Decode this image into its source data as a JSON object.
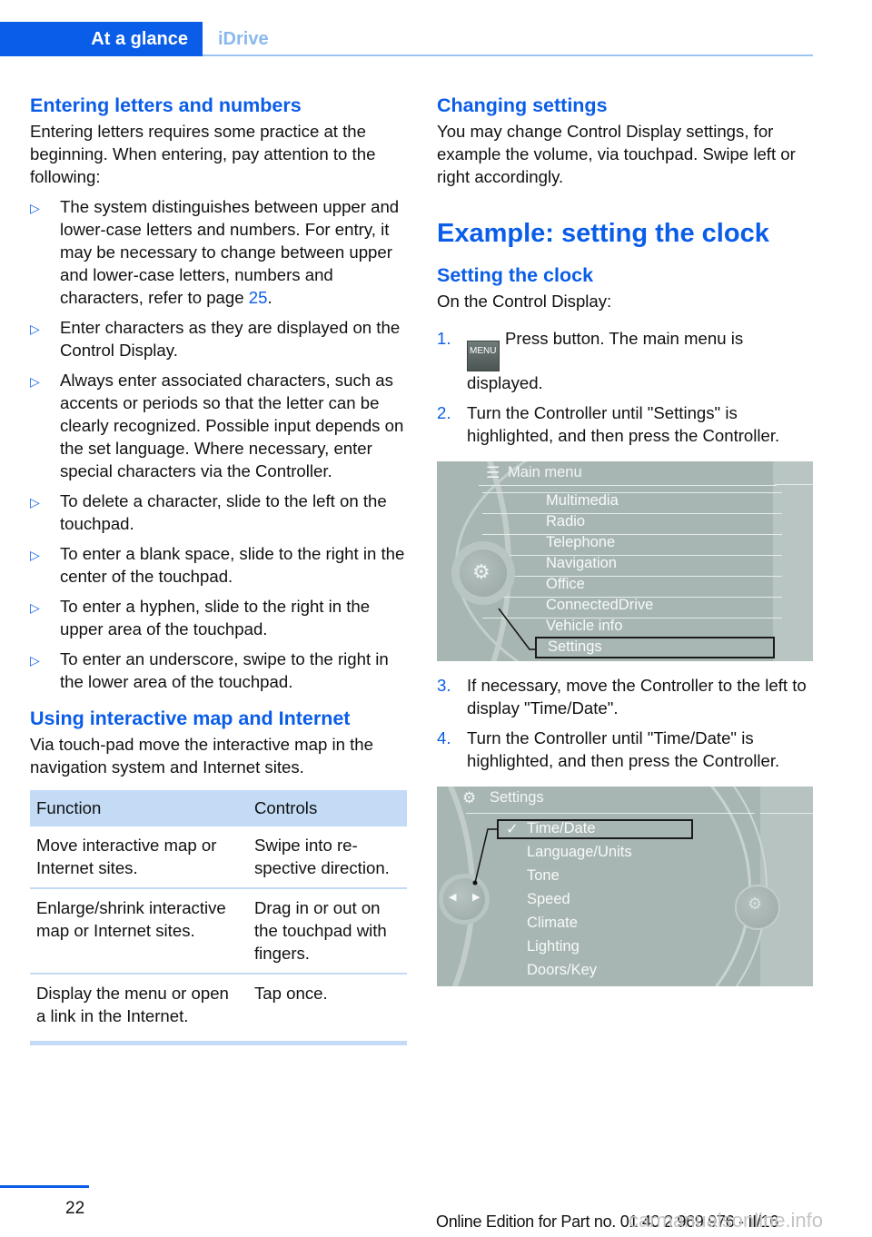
{
  "header": {
    "active_tab": "At a glance",
    "inactive_tab": "iDrive"
  },
  "left": {
    "section1": {
      "title": "Entering letters and numbers",
      "intro": "Entering letters requires some practice at the beginning. When entering, pay attention to the following:",
      "bullets": [
        {
          "text": "The system distinguishes between upper and lower-case letters and numbers. For entry, it may be necessary to change between upper and lower-case letters, numbers and characters, refer to page ",
          "link": "25",
          "after": "."
        },
        {
          "text": "Enter characters as they are displayed on the Control Display."
        },
        {
          "text": "Always enter associated characters, such as accents or periods so that the letter can be clearly recognized. Possible input depends on the set language. Where necessary, enter special characters via the Controller."
        },
        {
          "text": "To delete a character, slide to the left on the touchpad."
        },
        {
          "text": "To enter a blank space, slide to the right in the center of the touchpad."
        },
        {
          "text": "To enter a hyphen, slide to the right in the upper area of the touchpad."
        },
        {
          "text": "To enter an underscore, swipe to the right in the lower area of the touchpad."
        }
      ],
      "bullet_glyph": "▷"
    },
    "section2": {
      "title": "Using interactive map and Internet",
      "intro": "Via touch-pad move the interactive map in the navigation system and Internet sites.",
      "table": {
        "headers": [
          "Function",
          "Controls"
        ],
        "rows": [
          [
            "Move interactive map or Internet sites.",
            "Swipe into re­spective direc­tion."
          ],
          [
            "Enlarge/shrink interactive map or Internet sites.",
            "Drag in or out on the touchpad with fingers."
          ],
          [
            "Display the menu or open a link in the Internet.",
            "Tap once."
          ]
        ]
      }
    }
  },
  "right": {
    "section1": {
      "title": "Changing settings",
      "body": "You may change Control Display settings, for example the volume, via touchpad. Swipe left or right accordingly."
    },
    "section2": {
      "title": "Example: setting the clock",
      "subtitle": "Setting the clock",
      "intro": "On the Control Display:",
      "steps": [
        {
          "num": "1.",
          "icon_label": "MENU",
          "text": "Press button. The main menu is displayed."
        },
        {
          "num": "2.",
          "text": "Turn the Controller until \"Settings\" is highlighted, and then press the Controller."
        },
        {
          "num": "3.",
          "text": "If necessary, move the Controller to the left to display \"Time/Date\"."
        },
        {
          "num": "4.",
          "text": "Turn the Controller until \"Time/Date\" is highlighted, and then press the Controller."
        }
      ]
    },
    "screen1": {
      "title": "Main menu",
      "items": [
        "Multimedia",
        "Radio",
        "Telephone",
        "Navigation",
        "Office",
        "ConnectedDrive",
        "Vehicle info",
        "Settings"
      ],
      "highlighted": "Settings"
    },
    "screen2": {
      "title": "Settings",
      "items": [
        "Time/Date",
        "Language/Units",
        "Tone",
        "Speed",
        "Climate",
        "Lighting",
        "Doors/Key"
      ],
      "highlighted": "Time/Date",
      "check_glyph": "✓"
    }
  },
  "footer": {
    "page_number": "22",
    "edition": "Online Edition for Part no. 01 40 2 969 976 - II/16",
    "watermark": "carmanualsonline.info"
  },
  "colors": {
    "accent": "#0a5de8",
    "tab_inactive": "#8ab8ee",
    "table_header": "#c3dbf5",
    "screen_bg": "#a8b6b3"
  }
}
